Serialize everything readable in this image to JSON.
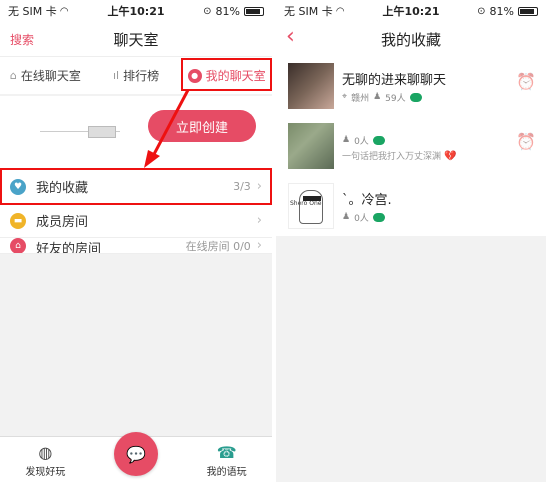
{
  "status": {
    "carrier": "无 SIM 卡",
    "time": "上午10:21",
    "battery": "81%"
  },
  "left": {
    "nav_left": "搜索",
    "title": "聊天室",
    "tabs": [
      {
        "label": "在线聊天室",
        "icon": "chat-bubbles-icon"
      },
      {
        "label": "排行榜",
        "icon": "ranking-bars-icon"
      },
      {
        "label": "我的聊天室",
        "icon": "user-icon"
      }
    ],
    "create_button": "立即创建",
    "rows": [
      {
        "label": "我的收藏",
        "meta": "3/3",
        "color": "#4aa3c8"
      },
      {
        "label": "成员房间",
        "meta": "",
        "color": "#f0b429"
      },
      {
        "label": "好友的房间",
        "meta": "在线房间 0/0",
        "color": "#e64c65"
      }
    ],
    "bottom": [
      {
        "label": "发现好玩",
        "icon": "globe-icon"
      },
      {
        "label": "我的语玩",
        "icon": "phone-icon"
      }
    ]
  },
  "right": {
    "title": "我的收藏",
    "favorites": [
      {
        "name": "无聊的进来聊聊天",
        "location": "赣州",
        "count": "59人",
        "note": ""
      },
      {
        "name": "",
        "location": "",
        "count": "0人",
        "note": "一句话把我打入万丈深渊"
      },
      {
        "name": "`。冷宫.",
        "location": "",
        "count": "0人",
        "note": ""
      }
    ],
    "sketch_signature": "Shero One"
  },
  "colors": {
    "accent": "#e64c65",
    "highlight": "#e11111",
    "online": "#1aa563"
  }
}
